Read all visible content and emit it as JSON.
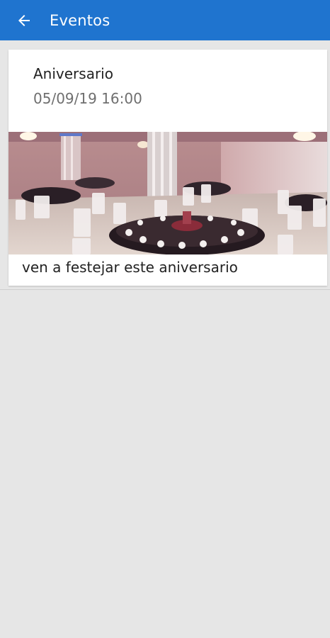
{
  "app_bar": {
    "title": "Eventos",
    "back_icon": "arrow-left-icon",
    "color": "#1f74cf"
  },
  "events": [
    {
      "title": "Aniversario",
      "datetime": "05/09/19 16:00",
      "description": "ven a festejar este aniversario"
    }
  ]
}
